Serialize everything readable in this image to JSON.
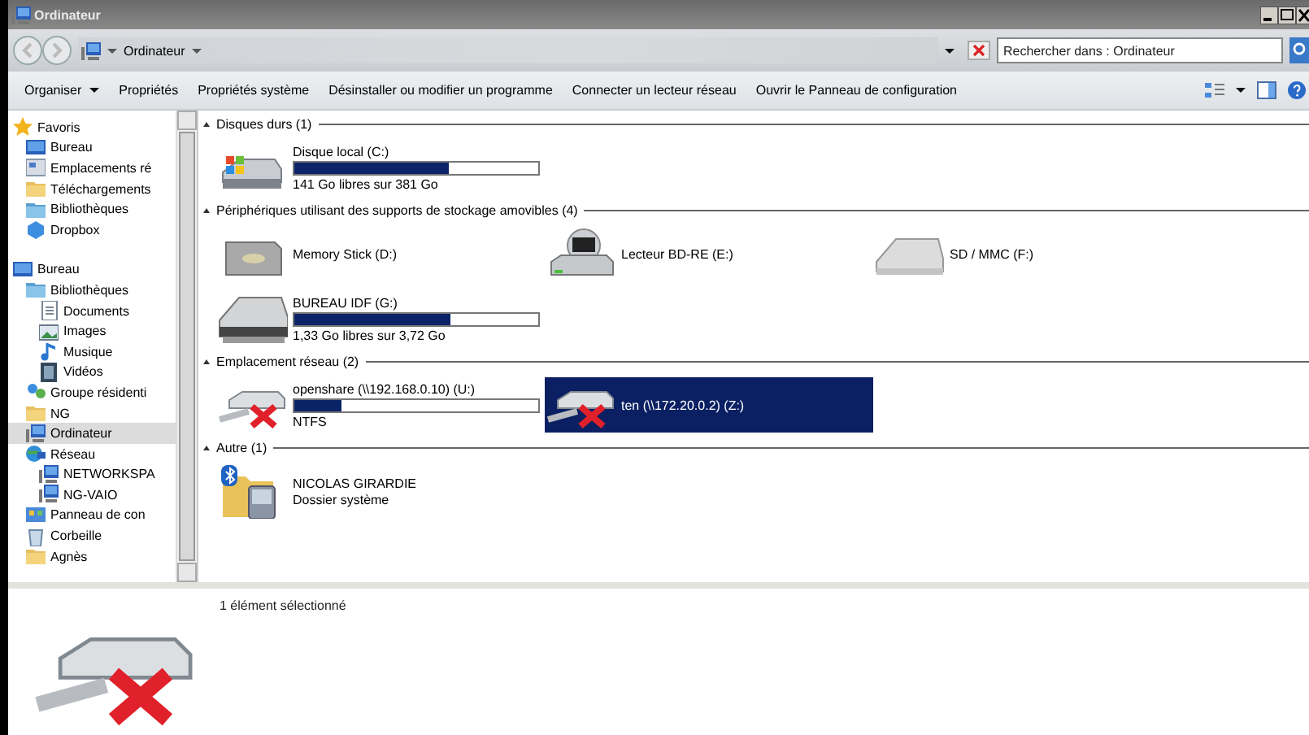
{
  "window": {
    "title": "Ordinateur"
  },
  "address": {
    "path": "Ordinateur",
    "search_placeholder": "Rechercher dans : Ordinateur"
  },
  "toolbar": {
    "items": [
      {
        "label": "Organiser",
        "kind": "menu"
      },
      {
        "label": "Propriétés",
        "kind": "command"
      },
      {
        "label": "Propriétés système",
        "kind": "command"
      },
      {
        "label": "Désinstaller ou modifier un programme",
        "kind": "command"
      },
      {
        "label": "Connecter un lecteur réseau",
        "kind": "command"
      },
      {
        "label": "Ouvrir le Panneau de configuration",
        "kind": "command"
      }
    ]
  },
  "sidebar": {
    "items": [
      {
        "label": "Favoris",
        "selected": false,
        "children": [
          {
            "label": "Bureau",
            "selected": false
          },
          {
            "label": "Emplacements ré",
            "selected": false
          },
          {
            "label": "Téléchargements",
            "selected": false
          },
          {
            "label": "Bibliothèques",
            "selected": false
          },
          {
            "label": "Dropbox",
            "selected": false
          }
        ]
      },
      {
        "label": "Bureau",
        "selected": false,
        "children": [
          {
            "label": "Bibliothèques",
            "selected": false,
            "children": [
              {
                "label": "Documents",
                "selected": false
              },
              {
                "label": "Images",
                "selected": false
              },
              {
                "label": "Musique",
                "selected": false
              },
              {
                "label": "Vidéos",
                "selected": false
              }
            ]
          },
          {
            "label": "Groupe résidenti",
            "selected": false
          },
          {
            "label": "NG",
            "selected": false
          },
          {
            "label": "Ordinateur",
            "selected": true
          },
          {
            "label": "Réseau",
            "selected": false,
            "children": [
              {
                "label": "NETWORKSPA",
                "selected": false
              },
              {
                "label": "NG-VAIO",
                "selected": false
              }
            ]
          },
          {
            "label": "Panneau de con",
            "selected": false
          },
          {
            "label": "Corbeille",
            "selected": false
          },
          {
            "label": "Agnès",
            "selected": false
          }
        ]
      }
    ]
  },
  "groups": [
    {
      "title": "Disques durs (1)",
      "items": [
        {
          "kind": "drive",
          "name": "Disque local (C:)",
          "level": 0.63,
          "detail": "141 Go libres sur 381 Go",
          "selected": false
        }
      ]
    },
    {
      "title": "Périphériques utilisant des supports de stockage amovibles (4)",
      "items": [
        {
          "kind": "device",
          "name": "Memory Stick (D:)",
          "selected": false
        },
        {
          "kind": "device",
          "name": "Lecteur BD-RE (E:)",
          "selected": false
        },
        {
          "kind": "device",
          "name": "SD / MMC (F:)",
          "selected": false
        },
        {
          "kind": "drive",
          "name": "BUREAU IDF (G:)",
          "level": 0.64,
          "detail": "1,33 Go libres sur 3,72 Go",
          "selected": false
        }
      ]
    },
    {
      "title": "Emplacement réseau (2)",
      "items": [
        {
          "kind": "drive",
          "name": "openshare (\\\\192.168.0.10) (U:)",
          "level": 0.19,
          "detail": "NTFS",
          "selected": false
        },
        {
          "kind": "device",
          "name": "ten (\\\\172.20.0.2) (Z:)",
          "selected": true
        }
      ]
    },
    {
      "title": "Autre (1)",
      "items": [
        {
          "kind": "system",
          "name": "NICOLAS GIRARDIE",
          "detail": "Dossier système",
          "selected": false
        }
      ]
    }
  ],
  "details": {
    "summary": "1 élément sélectionné"
  }
}
